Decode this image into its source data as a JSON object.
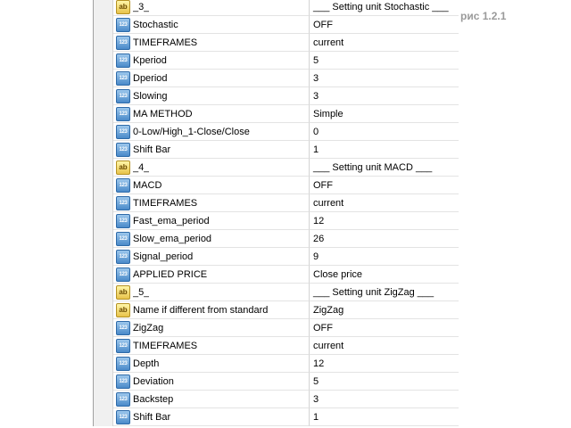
{
  "caption": "рис 1.2.1",
  "rows": [
    {
      "icon": "ab",
      "icon_name": "string-type-icon",
      "name": "_3_",
      "value": "___ Setting unit Stochastic ___"
    },
    {
      "icon": "123",
      "icon_name": "number-type-icon",
      "name": "Stochastic",
      "value": "OFF"
    },
    {
      "icon": "123",
      "icon_name": "number-type-icon",
      "name": "TIMEFRAMES",
      "value": "current"
    },
    {
      "icon": "123",
      "icon_name": "number-type-icon",
      "name": "Kperiod",
      "value": "5"
    },
    {
      "icon": "123",
      "icon_name": "number-type-icon",
      "name": "Dperiod",
      "value": "3"
    },
    {
      "icon": "123",
      "icon_name": "number-type-icon",
      "name": "Slowing",
      "value": "3"
    },
    {
      "icon": "123",
      "icon_name": "number-type-icon",
      "name": "MA METHOD",
      "value": "Simple"
    },
    {
      "icon": "123",
      "icon_name": "number-type-icon",
      "name": "0-Low/High_1-Close/Close",
      "value": "0"
    },
    {
      "icon": "123",
      "icon_name": "number-type-icon",
      "name": "Shift Bar",
      "value": "1"
    },
    {
      "icon": "ab",
      "icon_name": "string-type-icon",
      "name": "_4_",
      "value": "___ Setting unit MACD ___"
    },
    {
      "icon": "123",
      "icon_name": "number-type-icon",
      "name": "MACD",
      "value": "OFF"
    },
    {
      "icon": "123",
      "icon_name": "number-type-icon",
      "name": "TIMEFRAMES",
      "value": "current"
    },
    {
      "icon": "123",
      "icon_name": "number-type-icon",
      "name": "Fast_ema_period",
      "value": "12"
    },
    {
      "icon": "123",
      "icon_name": "number-type-icon",
      "name": "Slow_ema_period",
      "value": "26"
    },
    {
      "icon": "123",
      "icon_name": "number-type-icon",
      "name": "Signal_period",
      "value": "9"
    },
    {
      "icon": "123",
      "icon_name": "number-type-icon",
      "name": "APPLIED PRICE",
      "value": "Close price"
    },
    {
      "icon": "ab",
      "icon_name": "string-type-icon",
      "name": "_5_",
      "value": "___ Setting unit ZigZag ___"
    },
    {
      "icon": "ab",
      "icon_name": "string-type-icon",
      "name": "Name if different from standard",
      "value": "ZigZag"
    },
    {
      "icon": "123",
      "icon_name": "number-type-icon",
      "name": "ZigZag",
      "value": "OFF"
    },
    {
      "icon": "123",
      "icon_name": "number-type-icon",
      "name": "TIMEFRAMES",
      "value": "current"
    },
    {
      "icon": "123",
      "icon_name": "number-type-icon",
      "name": "Depth",
      "value": "12"
    },
    {
      "icon": "123",
      "icon_name": "number-type-icon",
      "name": "Deviation",
      "value": "5"
    },
    {
      "icon": "123",
      "icon_name": "number-type-icon",
      "name": "Backstep",
      "value": "3"
    },
    {
      "icon": "123",
      "icon_name": "number-type-icon",
      "name": "Shift Bar",
      "value": "1"
    }
  ]
}
